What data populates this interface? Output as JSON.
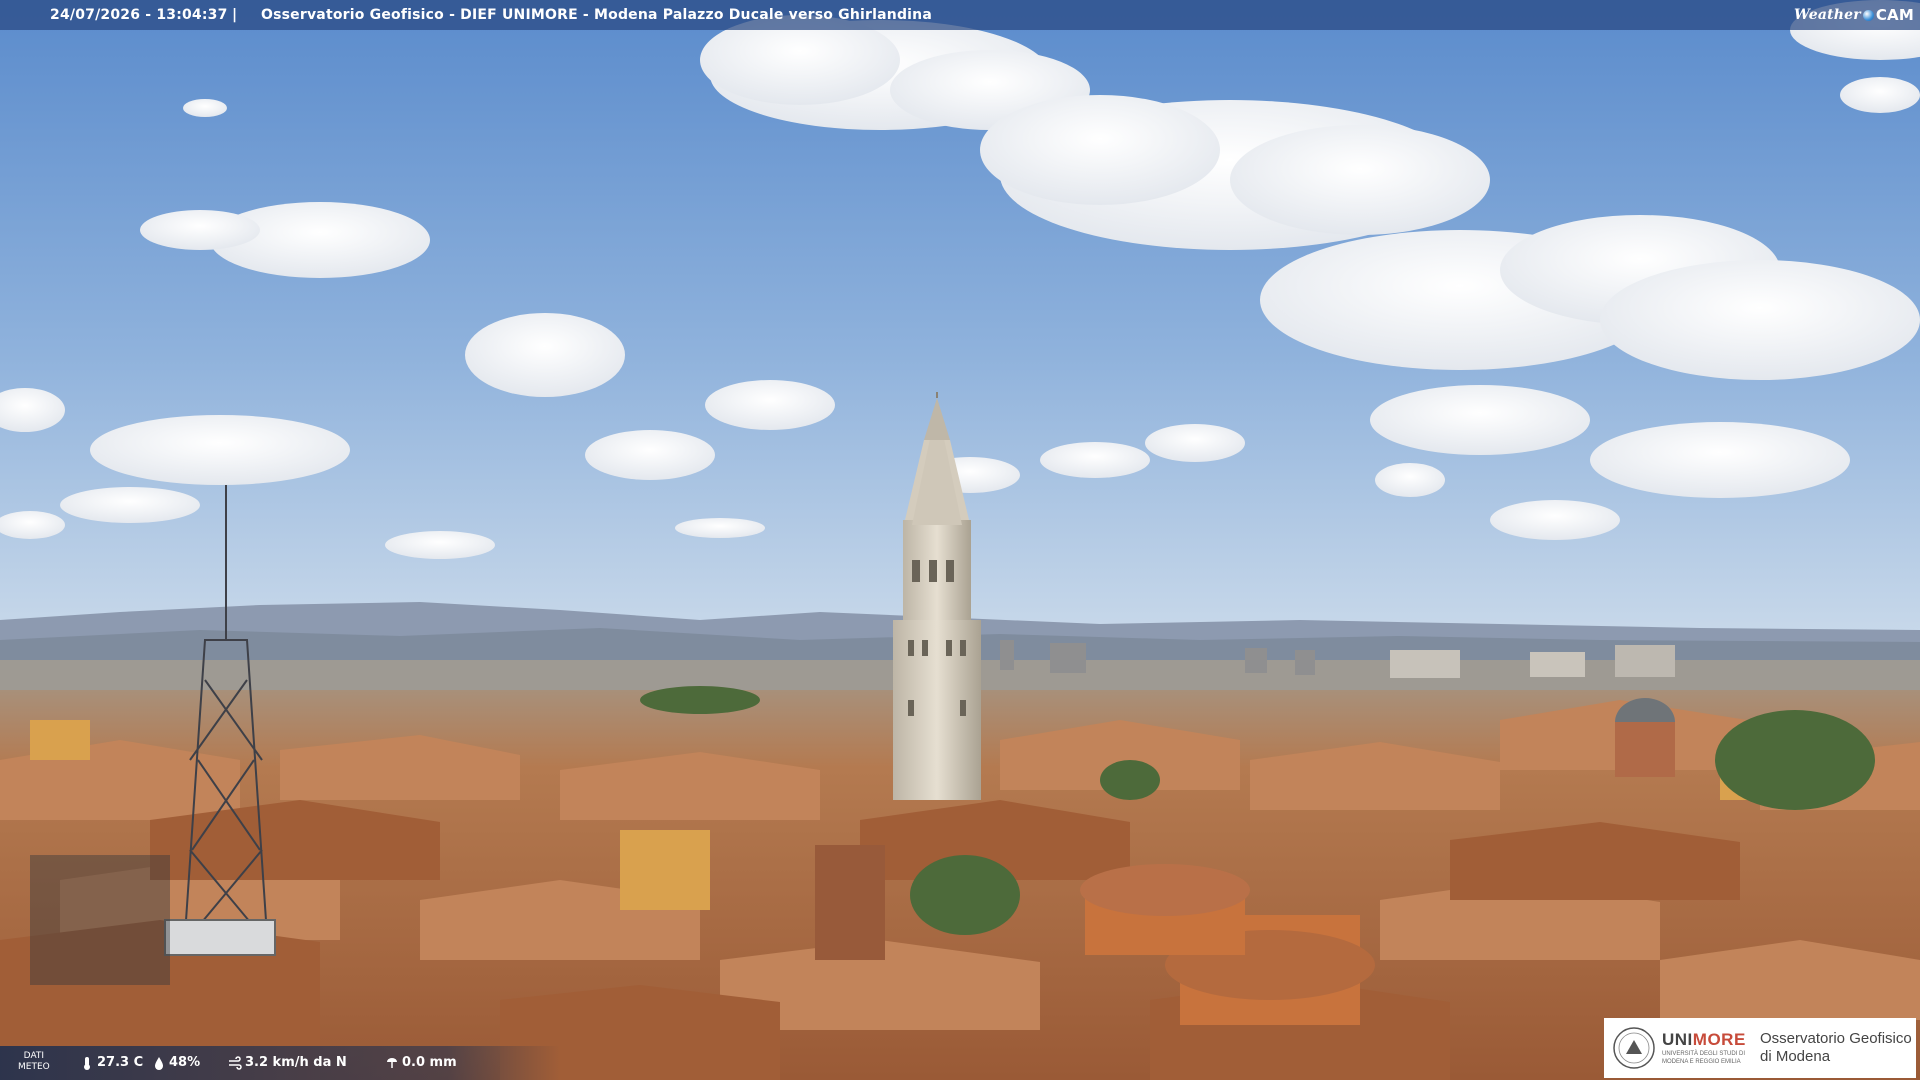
{
  "header": {
    "timestamp": "24/07/2026 - 13:04:37",
    "separator": "|",
    "title": "Osservatorio Geofisico - DIEF UNIMORE - Modena Palazzo Ducale verso Ghirlandina",
    "brand_weather": "Weather",
    "brand_cam": "CAM"
  },
  "meteo": {
    "label_line1": "DATI",
    "label_line2": "METEO",
    "temperature": "27.3 C",
    "humidity": "48%",
    "wind": "3.2 km/h da N",
    "rain": "0.0 mm",
    "icons": [
      "thermometer-icon",
      "humidity-icon",
      "wind-icon",
      "rain-gauge-icon"
    ]
  },
  "logo": {
    "name_prefix": "UNI",
    "name_accent": "MORE",
    "university_sub_line1": "UNIVERSITÀ DEGLI STUDI DI",
    "university_sub_line2": "MODENA E REGGIO EMILIA",
    "observatory_line1": "Osservatorio Geofisico",
    "observatory_line2": "di Modena"
  },
  "colors": {
    "sky_top": "#5f8fcf",
    "sky_bottom": "#bcd2ea",
    "roofs": "#b9774a",
    "tower_stone": "#d9d2c4",
    "hills": "#8e9cb0",
    "overlay_bar": "#284882",
    "logo_accent": "#c74b3a"
  }
}
